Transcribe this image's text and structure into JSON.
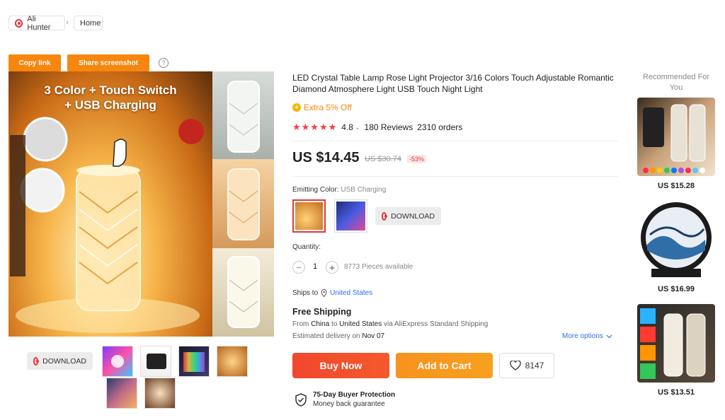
{
  "breadcrumb": {
    "app": "Ali Hunter",
    "home": "Home"
  },
  "actions": {
    "copy_link": "Copy link",
    "share_screenshot": "Share screenshot",
    "help": "?"
  },
  "gallery": {
    "headline_line1": "3 Color + Touch Switch",
    "headline_line2": "+ USB Charging",
    "download_label": "DOWNLOAD"
  },
  "product": {
    "title": "LED Crystal Table Lamp Rose Light Projector 3/16 Colors Touch Adjustable Romantic Diamond Atmosphere Light USB Touch Night Light",
    "promo": "Extra 5% Off",
    "stars": "★★★★★",
    "rating": "4.8",
    "reviews": "180 Reviews",
    "orders": "2310 orders",
    "price": "US $14.45",
    "old_price": "US $30.74",
    "discount": "-53%",
    "color_label": "Emitting Color:",
    "color_value": "USB Charging",
    "download_label": "DOWNLOAD",
    "quantity_label": "Quantity:",
    "quantity": "1",
    "available": "8773 Pieces available",
    "ships_to_label": "Ships to",
    "ships_to_country": "United States",
    "shipping_title": "Free Shipping",
    "shipping_from_prefix": "From",
    "shipping_from": "China",
    "shipping_to_word": "to",
    "shipping_to": "United States",
    "shipping_via": "via AliExpress Standard Shipping",
    "delivery_prefix": "Estimated delivery on",
    "delivery_date": "Nov 07",
    "more_options": "More options",
    "buy_now": "Buy Now",
    "add_to_cart": "Add to Cart",
    "wishlist_count": "8147",
    "protection_title": "75-Day Buyer Protection",
    "protection_sub": "Money back guarantee"
  },
  "recommended": {
    "title": "Recommended For You",
    "items": [
      {
        "price": "US $15.28"
      },
      {
        "price": "US $16.99"
      },
      {
        "price": "US $13.51"
      }
    ]
  },
  "colors": {
    "accent": "#f7860e",
    "buy_now": "#f2472e",
    "add_to_cart": "#f7931e",
    "star": "#ff3b3b",
    "link": "#2e6ce0"
  }
}
